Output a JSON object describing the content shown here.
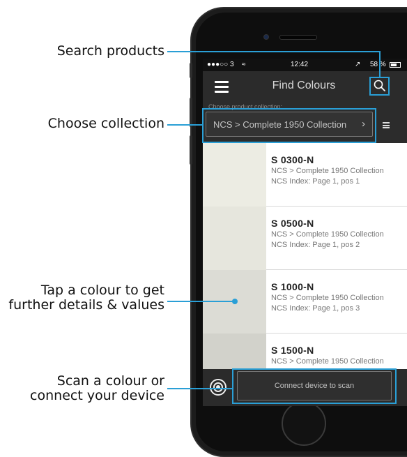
{
  "callouts": {
    "search": "Search products",
    "collection": "Choose collection",
    "tap_line1": "Tap a colour to get",
    "tap_line2": "further details & values",
    "scan_line1": "Scan a colour or",
    "scan_line2": "connect your device"
  },
  "status_bar": {
    "carrier": "●●●○○ 3",
    "time": "12:42",
    "battery": "58 %"
  },
  "navbar": {
    "title": "Find Colours"
  },
  "collection": {
    "label": "Choose product collection:",
    "selected": "NCS > Complete 1950 Collection"
  },
  "colours": [
    {
      "code": "S 0300-N",
      "collection": "NCS > Complete 1950 Collection",
      "index": "NCS Index: Page 1, pos 1",
      "swatch": "#ecece3"
    },
    {
      "code": "S 0500-N",
      "collection": "NCS > Complete 1950 Collection",
      "index": "NCS Index: Page 1, pos 2",
      "swatch": "#e6e6dd"
    },
    {
      "code": "S 1000-N",
      "collection": "NCS > Complete 1950 Collection",
      "index": "NCS Index: Page 1, pos 3",
      "swatch": "#dcdcd5"
    },
    {
      "code": "S 1500-N",
      "collection": "NCS > Complete 1950 Collection",
      "index": "",
      "swatch": "#d2d2cb"
    }
  ],
  "connect_button": "Connect device to scan",
  "colors": {
    "accent": "#2a9fd6",
    "dark": "#2b2b2b"
  }
}
